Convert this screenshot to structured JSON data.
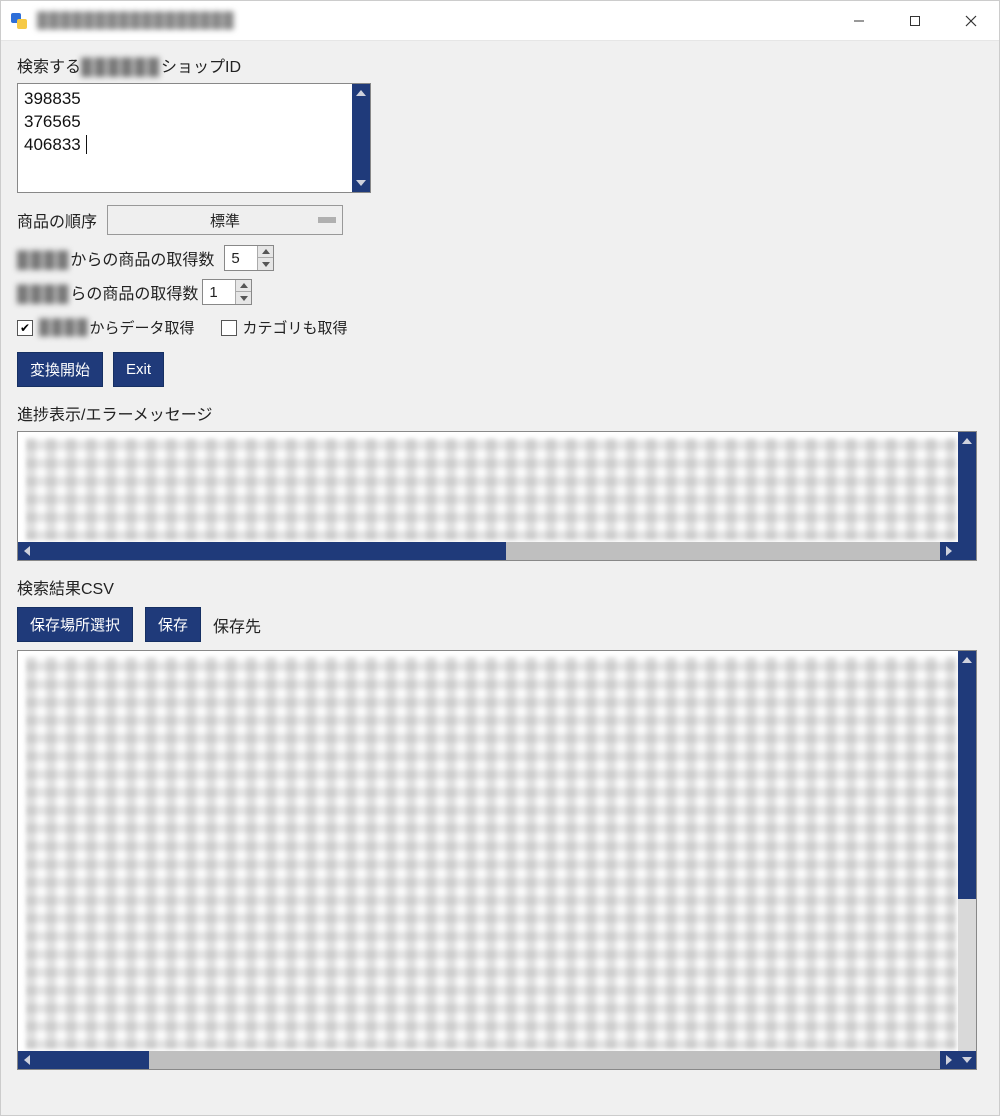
{
  "window": {
    "title": "█████████████████",
    "controls": {
      "minimize": "—",
      "maximize": "▢",
      "close": "✕"
    }
  },
  "labels": {
    "shop_id_prefix": "検索する",
    "shop_id_blurred": "██████",
    "shop_id_suffix": "ショップID",
    "order_label": "商品の順序",
    "order_value": "標準",
    "fetch_count1_prefix": "████",
    "fetch_count1_suffix": "からの商品の取得数",
    "fetch_count1_value": "5",
    "fetch_count2_prefix": "████",
    "fetch_count2_suffix": "らの商品の取得数",
    "fetch_count2_value": "1",
    "cb1_prefix": "████",
    "cb1_suffix": "からデータ取得",
    "cb2_label": "カテゴリも取得",
    "start_button": "変換開始",
    "exit_button": "Exit",
    "progress_label": "進捗表示/エラーメッセージ",
    "csv_label": "検索結果CSV",
    "choose_dest_button": "保存場所選択",
    "save_button": "保存",
    "dest_label": "保存先"
  },
  "shop_ids": [
    "398835",
    "376565",
    "406833"
  ],
  "checkboxes": {
    "data_fetch": true,
    "category_fetch": false
  },
  "colors": {
    "accent": "#1f3a7a",
    "window_bg": "#f0f0f0"
  }
}
